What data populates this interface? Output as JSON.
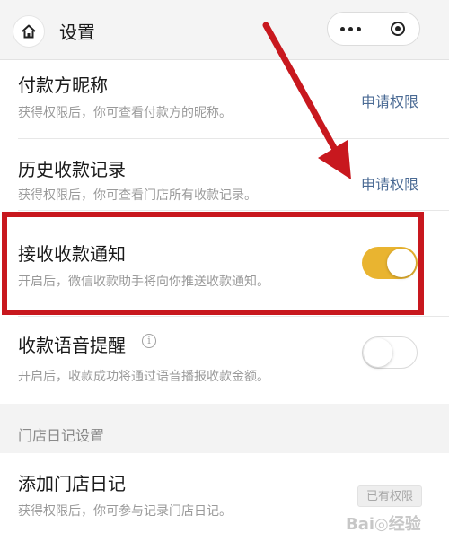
{
  "header": {
    "title": "设置"
  },
  "rows": [
    {
      "title": "付款方昵称",
      "desc": "获得权限后，你可查看付款方的昵称。",
      "action": "申请权限"
    },
    {
      "title": "历史收款记录",
      "desc": "获得权限后，你可查看门店所有收款记录。",
      "action": "申请权限"
    },
    {
      "title": "接收收款通知",
      "desc": "开启后，微信收款助手将向你推送收款通知。",
      "toggle": "on"
    },
    {
      "title": "收款语音提醒",
      "desc": "开启后，收款成功将通过语音播报收款金额。",
      "toggle": "off"
    }
  ],
  "section": {
    "label": "门店日记设置"
  },
  "diary_row": {
    "title": "添加门店日记",
    "desc": "获得权限后，你可参与记录门店日记。",
    "badge": "已有权限"
  },
  "watermark": "Bai◎经验",
  "colors": {
    "toggle_on": "#e9b430",
    "link": "#4a6a94",
    "annotation": "#c8181e"
  },
  "icons": [
    "home-icon",
    "more-icon",
    "close-capsule-icon",
    "info-icon"
  ]
}
